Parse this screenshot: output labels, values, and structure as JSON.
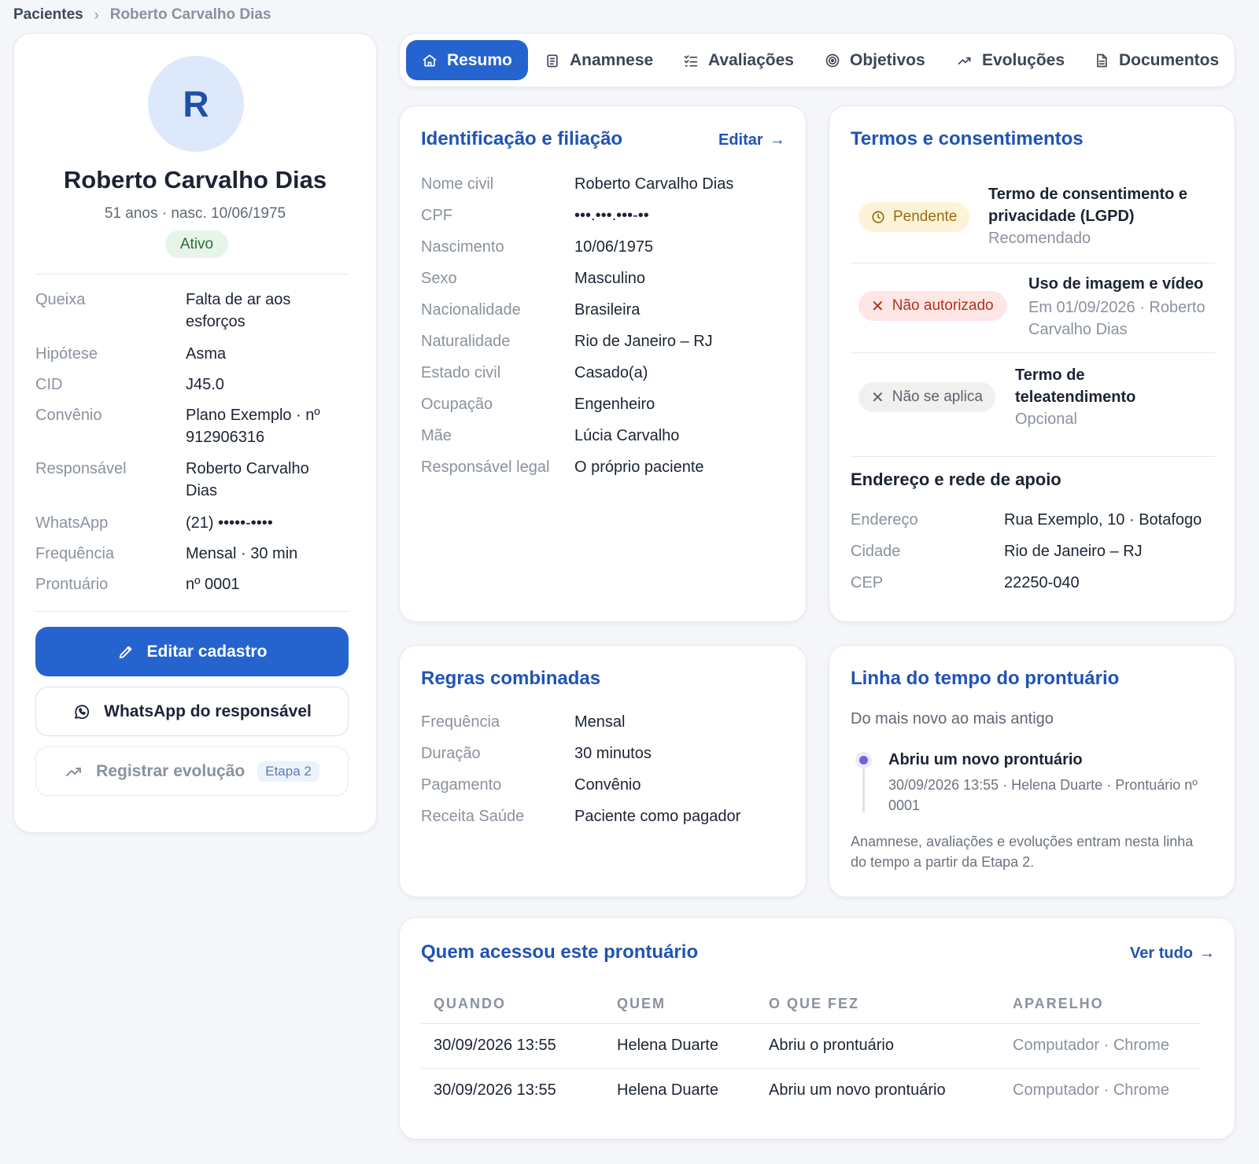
{
  "breadcrumb": {
    "root": "Pacientes",
    "current": "Roberto Carvalho Dias"
  },
  "profile": {
    "initial": "R",
    "name": "Roberto Carvalho Dias",
    "subtitle": "51 anos · nasc. 10/06/1975",
    "status": "Ativo",
    "fields": [
      {
        "label": "Queixa",
        "value": "Falta de ar aos esforços"
      },
      {
        "label": "Hipótese",
        "value": "Asma"
      },
      {
        "label": "CID",
        "value": "J45.0"
      },
      {
        "label": "Convênio",
        "value": "Plano Exemplo · nº 912906316"
      },
      {
        "label": "Responsável",
        "value": "Roberto Carvalho Dias"
      },
      {
        "label": "WhatsApp",
        "value": "(21) •••••-••••"
      },
      {
        "label": "Frequência",
        "value": "Mensal · 30 min"
      },
      {
        "label": "Prontuário",
        "value": "nº 0001"
      }
    ],
    "edit_button": "Editar cadastro",
    "whatsapp_button": "WhatsApp do responsável",
    "register_button": "Registrar evolução",
    "register_badge": "Etapa 2"
  },
  "tabs": [
    "Resumo",
    "Anamnese",
    "Avaliações",
    "Objetivos",
    "Evoluções",
    "Documentos"
  ],
  "identification": {
    "title": "Identificação e filiação",
    "edit_link": "Editar",
    "rows": [
      {
        "label": "Nome civil",
        "value": "Roberto Carvalho Dias"
      },
      {
        "label": "CPF",
        "value": "•••.•••.•••-••"
      },
      {
        "label": "Nascimento",
        "value": "10/06/1975"
      },
      {
        "label": "Sexo",
        "value": "Masculino"
      },
      {
        "label": "Nacionalidade",
        "value": "Brasileira"
      },
      {
        "label": "Naturalidade",
        "value": "Rio de Janeiro – RJ"
      },
      {
        "label": "Estado civil",
        "value": "Casado(a)"
      },
      {
        "label": "Ocupação",
        "value": "Engenheiro"
      },
      {
        "label": "Mãe",
        "value": "Lúcia Carvalho"
      },
      {
        "label": "Responsável legal",
        "value": "O próprio paciente"
      }
    ]
  },
  "terms": {
    "title": "Termos e consentimentos",
    "items": [
      {
        "status": "Pendente",
        "title": "Termo de consentimento e privacidade (LGPD)",
        "sub": "Recomendado"
      },
      {
        "status": "Não autorizado",
        "title": "Uso de imagem e vídeo",
        "sub": "Em 01/09/2026 · Roberto Carvalho Dias"
      },
      {
        "status": "Não se aplica",
        "title": "Termo de teleatendimento",
        "sub": "Opcional"
      }
    ],
    "address_title": "Endereço e rede de apoio",
    "address_rows": [
      {
        "label": "Endereço",
        "value": "Rua Exemplo, 10 · Botafogo"
      },
      {
        "label": "Cidade",
        "value": "Rio de Janeiro – RJ"
      },
      {
        "label": "CEP",
        "value": "22250-040"
      }
    ]
  },
  "rules": {
    "title": "Regras combinadas",
    "rows": [
      {
        "label": "Frequência",
        "value": "Mensal"
      },
      {
        "label": "Duração",
        "value": "30 minutos"
      },
      {
        "label": "Pagamento",
        "value": "Convênio"
      },
      {
        "label": "Receita Saúde",
        "value": "Paciente como pagador"
      }
    ]
  },
  "timeline": {
    "title": "Linha do tempo do prontuário",
    "subtitle": "Do mais novo ao mais antigo",
    "event_title": "Abriu um novo prontuário",
    "event_meta": "30/09/2026 13:55 · Helena Duarte · Prontuário nº 0001",
    "note": "Anamnese, avaliações e evoluções entram nesta linha do tempo a partir da Etapa 2."
  },
  "access": {
    "title": "Quem acessou este prontuário",
    "see_all": "Ver tudo",
    "headers": [
      "QUANDO",
      "QUEM",
      "O QUE FEZ",
      "APARELHO"
    ],
    "rows": [
      [
        "30/09/2026 13:55",
        "Helena Duarte",
        "Abriu o prontuário",
        "Computador · Chrome"
      ],
      [
        "30/09/2026 13:55",
        "Helena Duarte",
        "Abriu um novo prontuário",
        "Computador · Chrome"
      ]
    ]
  }
}
